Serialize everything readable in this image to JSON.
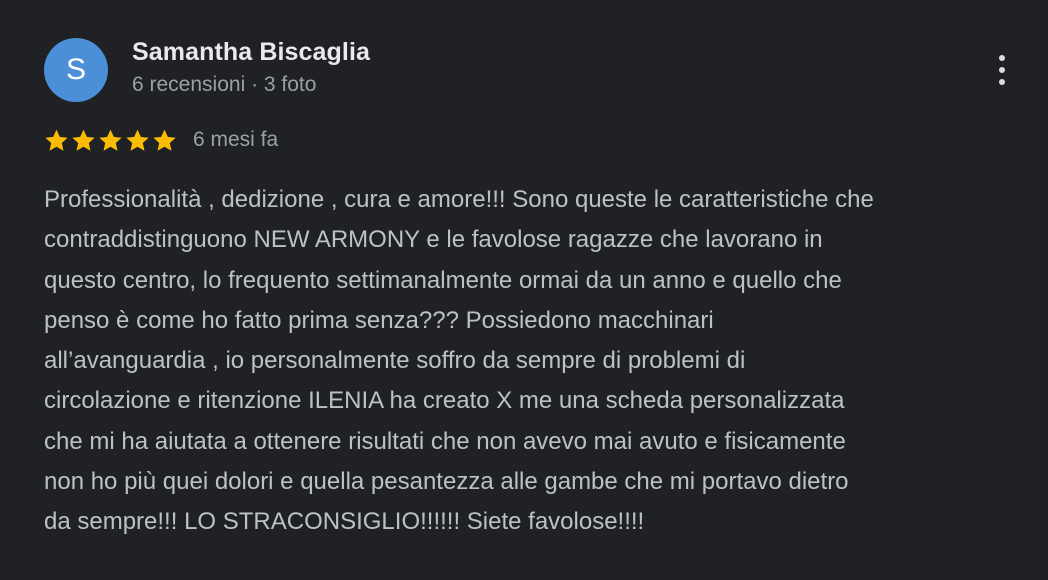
{
  "author": {
    "initial": "S",
    "name": "Samantha Biscaglia",
    "meta": "6 recensioni · 3 foto"
  },
  "menu": {
    "icon": "more-vertical-icon"
  },
  "rating": {
    "stars": 5,
    "max": 5,
    "star_color": "#fbbc04",
    "date": "6 mesi fa"
  },
  "review": {
    "lines": [
      "Professionalità , dedizione , cura e amore!!! Sono queste le caratteristiche che",
      "contraddistinguono NEW ARMONY e le favolose ragazze che lavorano in",
      "questo centro, lo frequento settimanalmente ormai da un anno e quello che",
      "penso è come ho fatto prima senza??? Possiedono macchinari",
      "all’avanguardia , io personalmente soffro da sempre di problemi di",
      "circolazione e ritenzione ILENIA ha creato X me una scheda personalizzata",
      "che mi ha aiutata a ottenere risultati che non avevo mai avuto e fisicamente",
      "non ho più quei dolori e quella pesantezza alle gambe che mi portavo dietro",
      "da sempre!!! LO STRACONSIGLIO!!!!!! Siete favolose!!!!"
    ]
  }
}
